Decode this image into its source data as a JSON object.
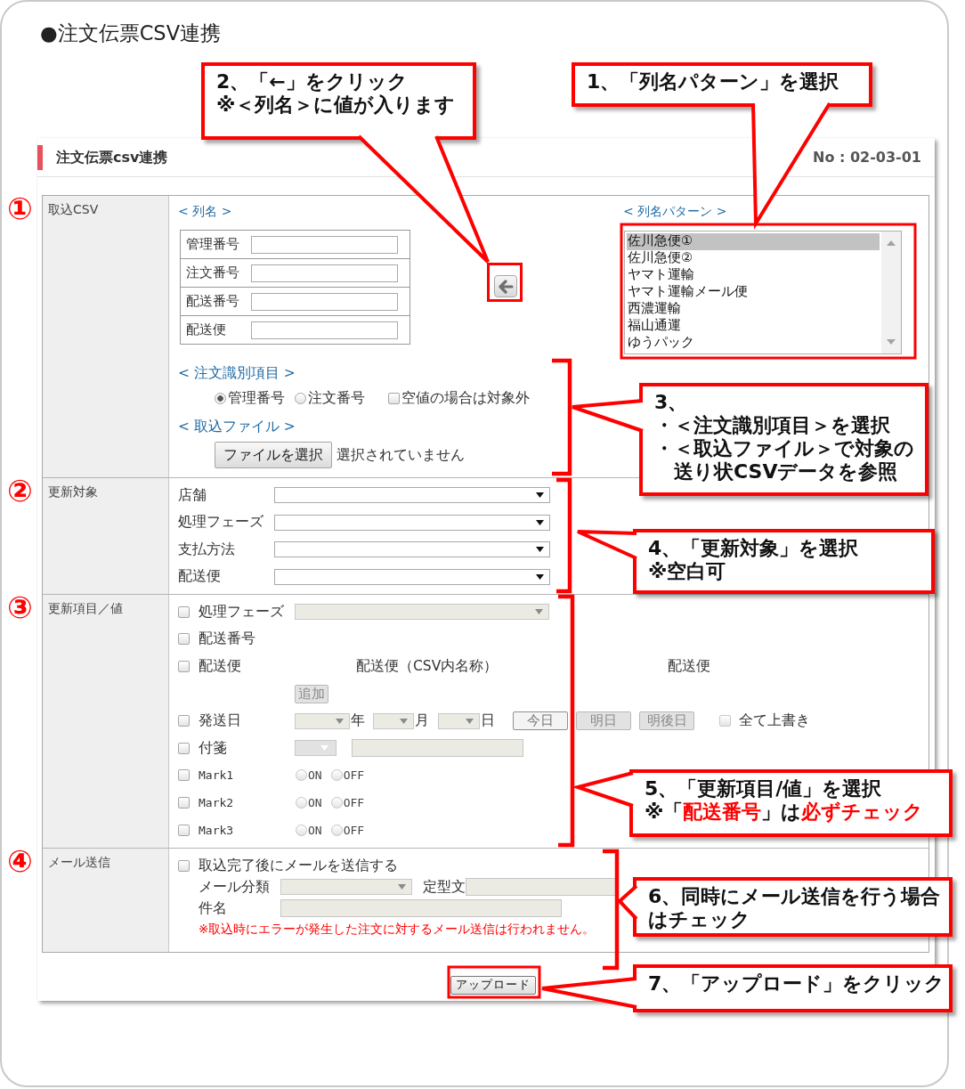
{
  "page_title": "●注文伝票CSV連携",
  "panel": {
    "title": "注文伝票csv連携",
    "code": "No : 02-03-01"
  },
  "sections": [
    {
      "kind": "import_csv",
      "marker": "①",
      "label": "取込CSV",
      "column_heading": "< 列名 >",
      "column_fields": [
        {
          "label": "管理番号"
        },
        {
          "label": "注文番号"
        },
        {
          "label": "配送番号"
        },
        {
          "label": "配送便"
        }
      ],
      "pattern_heading": "< 列名パターン >",
      "patterns": [
        {
          "label": "佐川急便①",
          "selected": true
        },
        {
          "label": "佐川急便②",
          "selected": false
        },
        {
          "label": "ヤマト運輸",
          "selected": false
        },
        {
          "label": "ヤマト運輸メール便",
          "selected": false
        },
        {
          "label": "西濃運輸",
          "selected": false
        },
        {
          "label": "福山通運",
          "selected": false
        },
        {
          "label": "ゆうパック",
          "selected": false
        }
      ],
      "id_heading": "< 注文識別項目 >",
      "id_options": [
        {
          "label": "管理番号",
          "selected": true
        },
        {
          "label": "注文番号",
          "selected": false
        }
      ],
      "skip_empty": {
        "label": "空値の場合は対象外",
        "checked": false
      },
      "file_heading": "< 取込ファイル >",
      "file_button": "ファイルを選択",
      "file_status": "選択されていません"
    },
    {
      "kind": "targets",
      "marker": "②",
      "label": "更新対象",
      "filters": [
        {
          "label": "店舗"
        },
        {
          "label": "処理フェーズ"
        },
        {
          "label": "支払方法"
        },
        {
          "label": "配送便"
        }
      ]
    },
    {
      "kind": "update_items",
      "marker": "③",
      "label": "更新項目／値",
      "items": [
        {
          "kind": "select",
          "label": "処理フェーズ",
          "checked": false,
          "select": {
            "disabled": true
          }
        },
        {
          "kind": "plain",
          "label": "配送番号",
          "checked": false
        },
        {
          "kind": "mapping",
          "label": "配送便",
          "checked": false,
          "column_1": "配送便（CSV内名称）",
          "column_2": "配送便",
          "add_button": {
            "label": "追加",
            "disabled": true
          }
        },
        {
          "kind": "date",
          "label": "発送日",
          "checked": false,
          "selects": [
            {
              "unit": "年",
              "disabled": true
            },
            {
              "unit": "月",
              "disabled": true
            },
            {
              "unit": "日",
              "disabled": true
            }
          ],
          "buttons": [
            {
              "label": "今日",
              "disabled": false
            },
            {
              "label": "明日",
              "disabled": true
            },
            {
              "label": "明後日",
              "disabled": true
            }
          ],
          "overwrite": {
            "label": "全て上書き",
            "checked": false
          }
        },
        {
          "kind": "tag",
          "label": "付箋",
          "checked": false,
          "select": {
            "disabled": true
          },
          "input": {
            "disabled": true
          }
        },
        {
          "kind": "switch",
          "label": "Mark1",
          "checked": false,
          "options": [
            {
              "label": "ON",
              "selected": false
            },
            {
              "label": "OFF",
              "selected": false
            }
          ]
        },
        {
          "kind": "switch",
          "label": "Mark2",
          "checked": false,
          "options": [
            {
              "label": "ON",
              "selected": false
            },
            {
              "label": "OFF",
              "selected": false
            }
          ]
        },
        {
          "kind": "switch",
          "label": "Mark3",
          "checked": false,
          "options": [
            {
              "label": "ON",
              "selected": false
            },
            {
              "label": "OFF",
              "selected": false
            }
          ]
        }
      ]
    },
    {
      "kind": "mail",
      "marker": "④",
      "label": "メール送信",
      "send_mail": {
        "label": "取込完了後にメールを送信する",
        "checked": false
      },
      "category": {
        "label": "メール分類",
        "disabled": true
      },
      "template": {
        "label": "定型文",
        "disabled": true
      },
      "subject": {
        "label": "件名",
        "disabled": true
      },
      "note": "※取込時にエラーが発生した注文に対するメール送信は行われません。"
    }
  ],
  "upload_button": "アップロード",
  "callouts": [
    {
      "kind": "text",
      "text": "2、「←」をクリック\n※＜列名＞に値が入ります"
    },
    {
      "kind": "text",
      "text": "1、「列名パターン」を選択"
    },
    {
      "kind": "list",
      "heading": "3、",
      "bullets": [
        "・＜注文識別項目＞を選択",
        "・＜取込ファイル＞で対象の送り状CSVデータを参照"
      ]
    },
    {
      "kind": "text",
      "text": "4、「更新対象」を選択\n※空白可"
    },
    {
      "kind": "text",
      "text": "5、「更新項目/値」を選択\n※「**配送番号**」は**必ずチェック**"
    },
    {
      "kind": "text",
      "text": "6、同時にメール送信を行う場合はチェック"
    },
    {
      "kind": "text",
      "text": "7、「アップロード」をクリック"
    }
  ]
}
